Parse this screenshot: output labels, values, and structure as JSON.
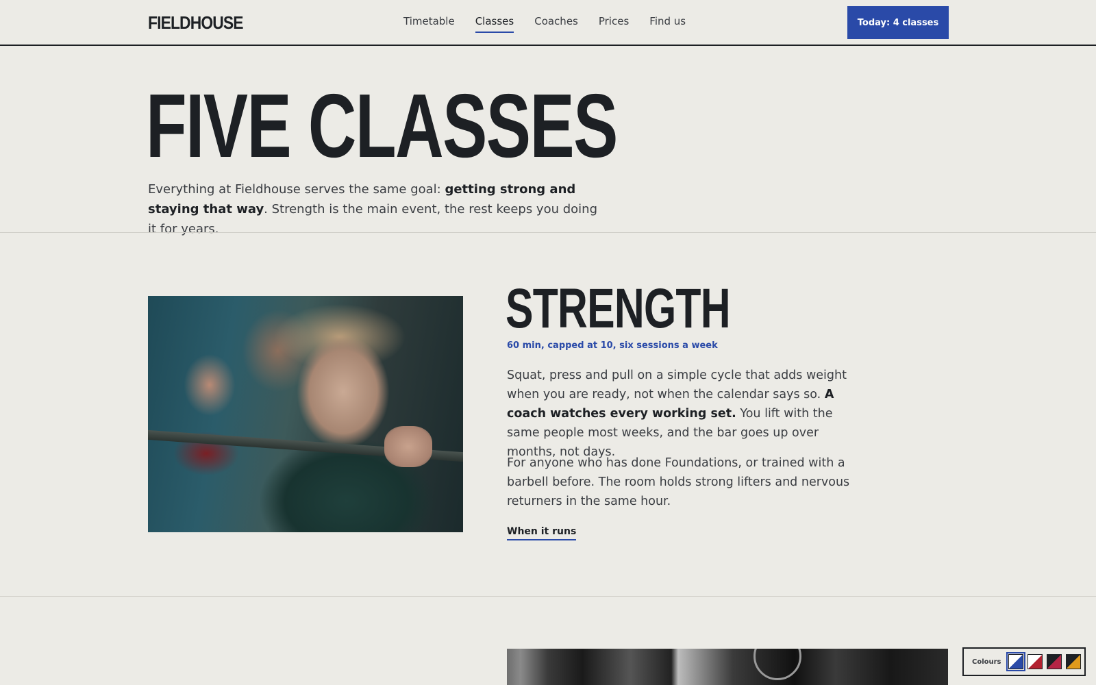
{
  "brand": {
    "logo": "FIELDHOUSE"
  },
  "nav": {
    "items": [
      {
        "label": "Timetable",
        "active": false
      },
      {
        "label": "Classes",
        "active": true
      },
      {
        "label": "Coaches",
        "active": false
      },
      {
        "label": "Prices",
        "active": false
      },
      {
        "label": "Find us",
        "active": false
      }
    ],
    "cta_label": "Today: 4 classes"
  },
  "hero": {
    "title": "FIVE CLASSES",
    "intro_before": "Everything at Fieldhouse serves the same goal: ",
    "intro_bold": "getting strong and staying that way",
    "intro_after": ". Strength is the main event, the rest keeps you doing it for years."
  },
  "strength": {
    "title": "STRENGTH",
    "meta": "60 min, capped at 10, six sessions a week",
    "para1_before": "Squat, press and pull on a simple cycle that adds weight when you are ready, not when the calendar says so. ",
    "para1_bold": "A coach watches every working set.",
    "para1_after": " You lift with the same people most weeks, and the bar goes up over months, not days.",
    "para2": "For anyone who has done Foundations, or trained with a barbell before. The room holds strong lifters and nervous returners in the same hour.",
    "link_label": "When it runs"
  },
  "colour_picker": {
    "label": "Colours",
    "swatches": [
      {
        "name": "blue",
        "colors": [
          "#2a4aa8",
          "#ffffff"
        ],
        "selected": true
      },
      {
        "name": "red",
        "colors": [
          "#b2202f",
          "#ffffff"
        ],
        "selected": false
      },
      {
        "name": "crimson",
        "colors": [
          "#b52545",
          "#1d2024"
        ],
        "selected": false
      },
      {
        "name": "amber",
        "colors": [
          "#e09a1c",
          "#1d2024"
        ],
        "selected": false
      }
    ]
  },
  "colors": {
    "background": "#ecebe6",
    "ink": "#1d2024",
    "accent": "#2a4aa8"
  }
}
